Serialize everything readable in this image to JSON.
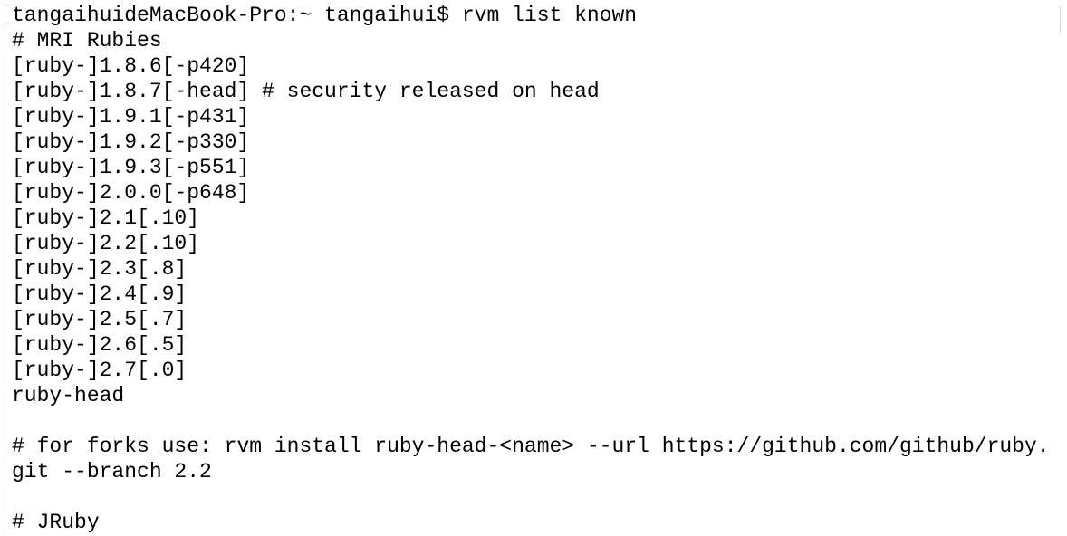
{
  "terminal": {
    "lines": [
      "tangaihuideMacBook-Pro:~ tangaihui$ rvm list known",
      "# MRI Rubies",
      "[ruby-]1.8.6[-p420]",
      "[ruby-]1.8.7[-head] # security released on head",
      "[ruby-]1.9.1[-p431]",
      "[ruby-]1.9.2[-p330]",
      "[ruby-]1.9.3[-p551]",
      "[ruby-]2.0.0[-p648]",
      "[ruby-]2.1[.10]",
      "[ruby-]2.2[.10]",
      "[ruby-]2.3[.8]",
      "[ruby-]2.4[.9]",
      "[ruby-]2.5[.7]",
      "[ruby-]2.6[.5]",
      "[ruby-]2.7[.0]",
      "ruby-head",
      "",
      "# for forks use: rvm install ruby-head-<name> --url https://github.com/github/ruby.",
      "git --branch 2.2",
      "",
      "# JRuby"
    ]
  },
  "colors": {
    "background": "#ffffff",
    "text": "#000000"
  }
}
